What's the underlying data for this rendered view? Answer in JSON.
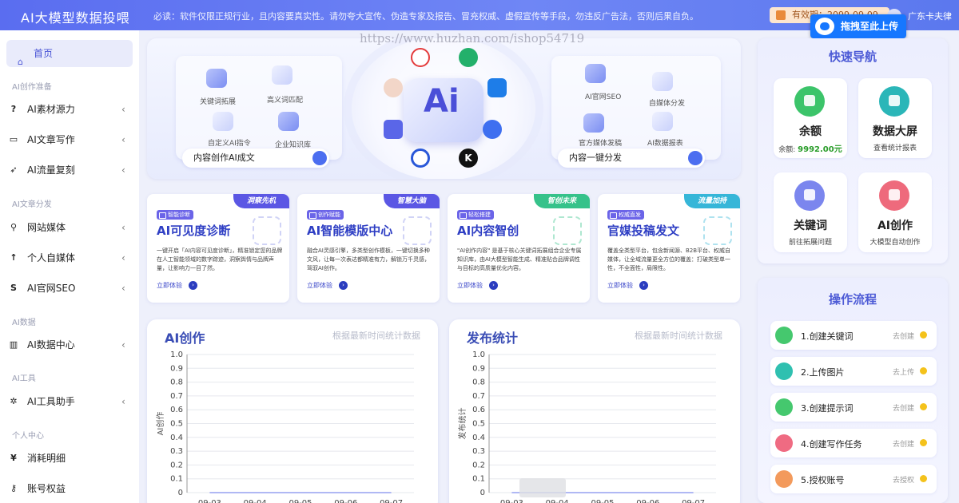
{
  "header": {
    "app_title": "AI大模型数据投喂",
    "notice": "必读：软件仅限正规行业，且内容要真实性。请勿夸大宣传、伪造专家及报告、冒充权威、虚假宣传等手段，勿违反广告法，否则后果自负。",
    "validity": "有效期：2099-09-09",
    "username": "广东卡夫律",
    "upload_label": "拖拽至此上传",
    "watermark": "https://www.huzhan.com/ishop54719"
  },
  "sidebar": {
    "home_label": "首页",
    "groups": [
      {
        "label": "AI创作准备"
      },
      {
        "label": "AI文章分发"
      },
      {
        "label": "AI数据"
      },
      {
        "label": "AI工具"
      },
      {
        "label": "个人中心"
      }
    ],
    "items": [
      {
        "label": "AI素材源力",
        "icon": "?"
      },
      {
        "label": "AI文章写作",
        "icon": "▭"
      },
      {
        "label": "AI流量复刻",
        "icon": "➶"
      },
      {
        "label": "网站媒体",
        "icon": "⚲"
      },
      {
        "label": "个人自媒体",
        "icon": "↑"
      },
      {
        "label": "AI官网SEO",
        "icon": "S"
      },
      {
        "label": "AI数据中心",
        "icon": "▥"
      },
      {
        "label": "AI工具助手",
        "icon": "✲"
      },
      {
        "label": "消耗明细",
        "icon": "¥"
      },
      {
        "label": "账号权益",
        "icon": "⚷"
      }
    ],
    "chevron": "‹"
  },
  "hero": {
    "left_labels": [
      "关键词拓展",
      "高义词匹配",
      "自定义AI指令",
      "企业知识库"
    ],
    "left_button": "内容创作AI成文",
    "right_labels": [
      "AI官网SEO",
      "自媒体分发",
      "官方媒体发稿",
      "AI数据报表"
    ],
    "right_button": "内容一键分发",
    "core_text": "Ai",
    "logo_letter": "K"
  },
  "cards": [
    {
      "corner": "洞察先机",
      "badge": "智能诊断",
      "title": "AI可见度诊断",
      "desc": "一键开启「AI内容可见度诊断」，精准锁定您的品牌在人工智能领域的数字踪迹，洞察舆情与品牌声量，让影响力一目了然。",
      "link": "立即体验",
      "accent": "#5b57e4"
    },
    {
      "corner": "智慧大脑",
      "badge": "创作赋能",
      "title": "AI智能模版中心",
      "desc": "融合AI灵感引擎，多类型创作模板，一键切换多种文风，让每一次表达都精准有力，解锁万千灵感，驾驭AI创作。",
      "link": "立即体验",
      "accent": "#5b57e4"
    },
    {
      "corner": "智创未来",
      "badge": "轻松搭建",
      "title": "AI内容智创",
      "desc": "\"AI创作内容\" 是基于核心关键词拓展组合企业专属知识库，由AI大模型智能生成、精准贴合品牌调性与目标的高质量优化内容。",
      "link": "立即体验",
      "accent": "#36c28a"
    },
    {
      "corner": "流量加持",
      "badge": "权威直发",
      "title": "官媒投稿发文",
      "desc": "覆盖全类型平台，包含新闻源、B2B平台、权威自媒体，让全域流量更全方位的覆盖：打破类型单一性，不全面性，局限性。",
      "link": "立即体验",
      "accent": "#36b6d8"
    }
  ],
  "charts": [
    {
      "title": "AI创作",
      "subtitle": "根据最新时间统计数据",
      "ylabel": "AI创作"
    },
    {
      "title": "发布统计",
      "subtitle": "根据最新时间统计数据",
      "ylabel": "发布统计"
    }
  ],
  "chart_data": [
    {
      "type": "line",
      "title": "AI创作",
      "ylabel": "AI创作",
      "ylim": [
        0,
        1
      ],
      "yticks": [
        "1.0",
        "0.9",
        "0.8",
        "0.7",
        "0.6",
        "0.5",
        "0.4",
        "0.3",
        "0.2",
        "0.1",
        "0"
      ],
      "xticks": [
        "09-03",
        "09-04",
        "09-05",
        "09-06",
        "09-07"
      ],
      "series": [
        {
          "values": [
            0,
            0,
            0,
            0,
            0
          ]
        }
      ]
    },
    {
      "type": "line",
      "title": "发布统计",
      "ylabel": "发布统计",
      "ylim": [
        0,
        1
      ],
      "yticks": [
        "1.0",
        "0.9",
        "0.8",
        "0.7",
        "0.6",
        "0.5",
        "0.4",
        "0.3",
        "0.2",
        "0.1",
        "0"
      ],
      "xticks": [
        "09-03",
        "09-04",
        "09-05",
        "09-06",
        "09-07"
      ],
      "series": [
        {
          "values": [
            0,
            0,
            0,
            0,
            0
          ]
        }
      ]
    }
  ],
  "quick_nav": {
    "title": "快速导航",
    "tiles": [
      {
        "title": "余额",
        "sub_prefix": "余额: ",
        "sub_value": "9992.00元",
        "color": "#3cc46a"
      },
      {
        "title": "数据大屏",
        "sub_prefix": "查看统计报表",
        "sub_value": "",
        "color": "#2bb6b8"
      },
      {
        "title": "关键词",
        "sub_prefix": "前往拓展问题",
        "sub_value": "",
        "color": "#7b86ee"
      },
      {
        "title": "AI创作",
        "sub_prefix": "大模型自动创作",
        "sub_value": "",
        "color": "#ee6a7c"
      }
    ]
  },
  "workflow": {
    "title": "操作流程",
    "steps": [
      {
        "label": "1.创建关键词",
        "action": "去创建",
        "color": "#45c86e"
      },
      {
        "label": "2.上传图片",
        "action": "去上传",
        "color": "#2fc0b0"
      },
      {
        "label": "3.创建提示词",
        "action": "去创建",
        "color": "#45c86e"
      },
      {
        "label": "4.创建写作任务",
        "action": "去创建",
        "color": "#ef6b82"
      },
      {
        "label": "5.授权账号",
        "action": "去授权",
        "color": "#f39a5c"
      }
    ]
  }
}
